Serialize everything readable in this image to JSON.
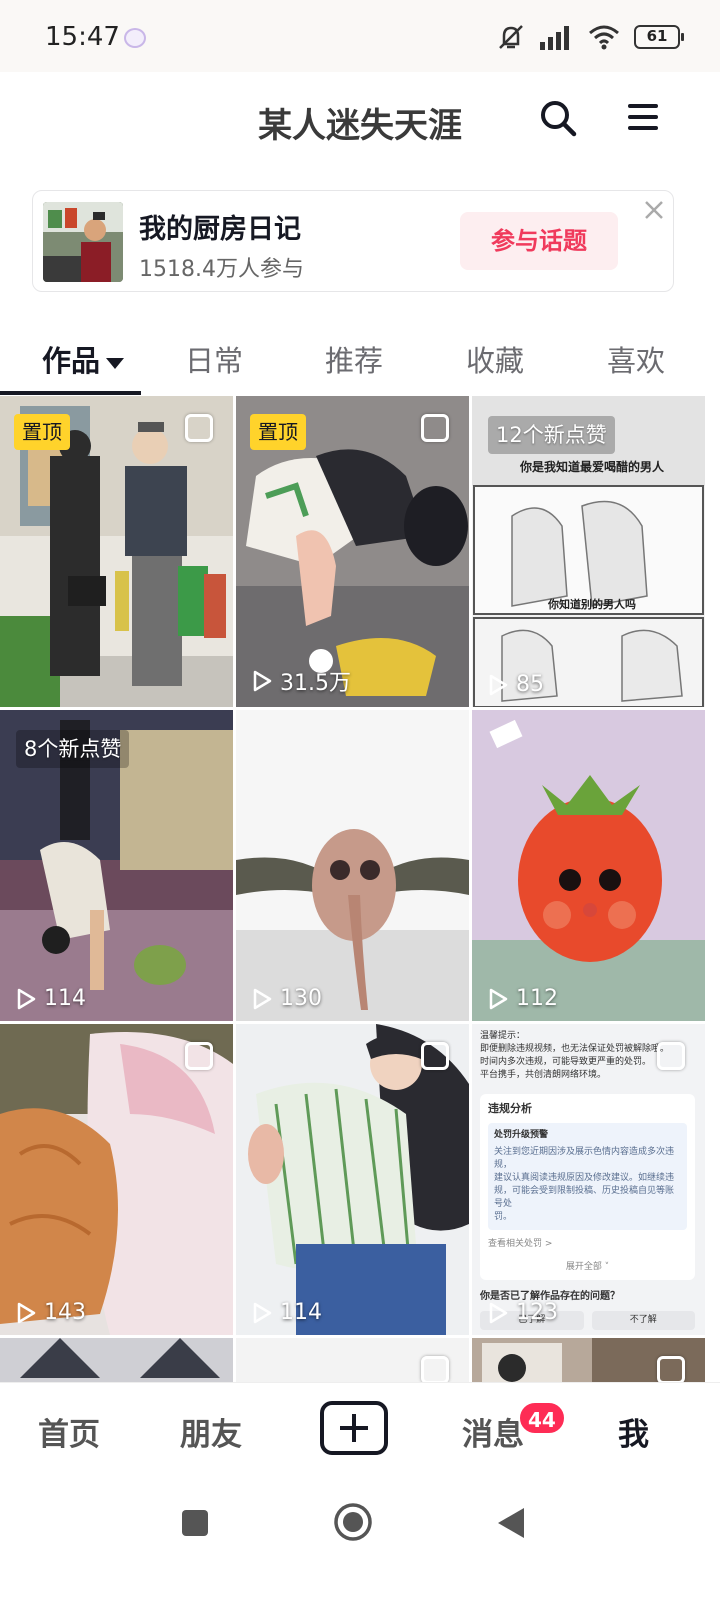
{
  "status_bar": {
    "time": "15:47",
    "battery": "61"
  },
  "header": {
    "title": "某人迷失天涯"
  },
  "topic": {
    "title": "我的厨房日记",
    "participants": "1518.4万人参与",
    "join_label": "参与话题"
  },
  "tabs": [
    {
      "label": "作品"
    },
    {
      "label": "日常"
    },
    {
      "label": "推荐"
    },
    {
      "label": "收藏"
    },
    {
      "label": "喜欢"
    }
  ],
  "grid": [
    {
      "pin": "置顶",
      "likes": "",
      "plays": ""
    },
    {
      "pin": "置顶",
      "likes": "",
      "plays": "31.5万"
    },
    {
      "pin": "",
      "likes": "12个新点赞",
      "plays": "85"
    },
    {
      "pin": "",
      "likes": "8个新点赞",
      "plays": "114"
    },
    {
      "pin": "",
      "likes": "",
      "plays": "130"
    },
    {
      "pin": "",
      "likes": "",
      "plays": "112"
    },
    {
      "pin": "",
      "likes": "",
      "plays": "143"
    },
    {
      "pin": "",
      "likes": "",
      "plays": "114"
    },
    {
      "pin": "",
      "likes": "",
      "plays": "123"
    }
  ],
  "cell3_text": {
    "line1": "你是我知道最爱喝醋的男人",
    "line2": "你知道别的男人吗"
  },
  "cell9_text": {
    "warn": "温馨提示：",
    "p1": "即便删除违规视频，也无法保证处罚被解除哦。",
    "p2": "时间内多次违规，可能导致更严重的处罚。",
    "p3": "平台携手，共创清朗网络环境。",
    "analysis": "违规分析",
    "upgrade": "处罚升级预警",
    "b1": "关注到您近期因涉及展示色情内容造成多次违规，",
    "b2": "建议认真阅读违规原因及修改建议。如继续违",
    "b3": "规，可能会受到限制投稿、历史投稿自见等账号处",
    "b4": "罚。",
    "link": "查看相关处罚 >",
    "expand": "展开全部 ˅",
    "question": "你是否已了解作品存在的问题？",
    "btn1": "已了解",
    "btn2": "不了解"
  },
  "bottom_nav": {
    "home": "首页",
    "friends": "朋友",
    "messages": "消息",
    "messages_badge": "44",
    "me": "我"
  },
  "icons": [
    "search-icon",
    "menu-icon",
    "close-icon",
    "mute-icon",
    "signal-icon",
    "wifi-icon",
    "battery-icon",
    "play-icon",
    "plus-icon"
  ],
  "colors": {
    "accent": "#fe2c55",
    "pin": "#ffd32b",
    "join_bg": "#fdeef0"
  }
}
